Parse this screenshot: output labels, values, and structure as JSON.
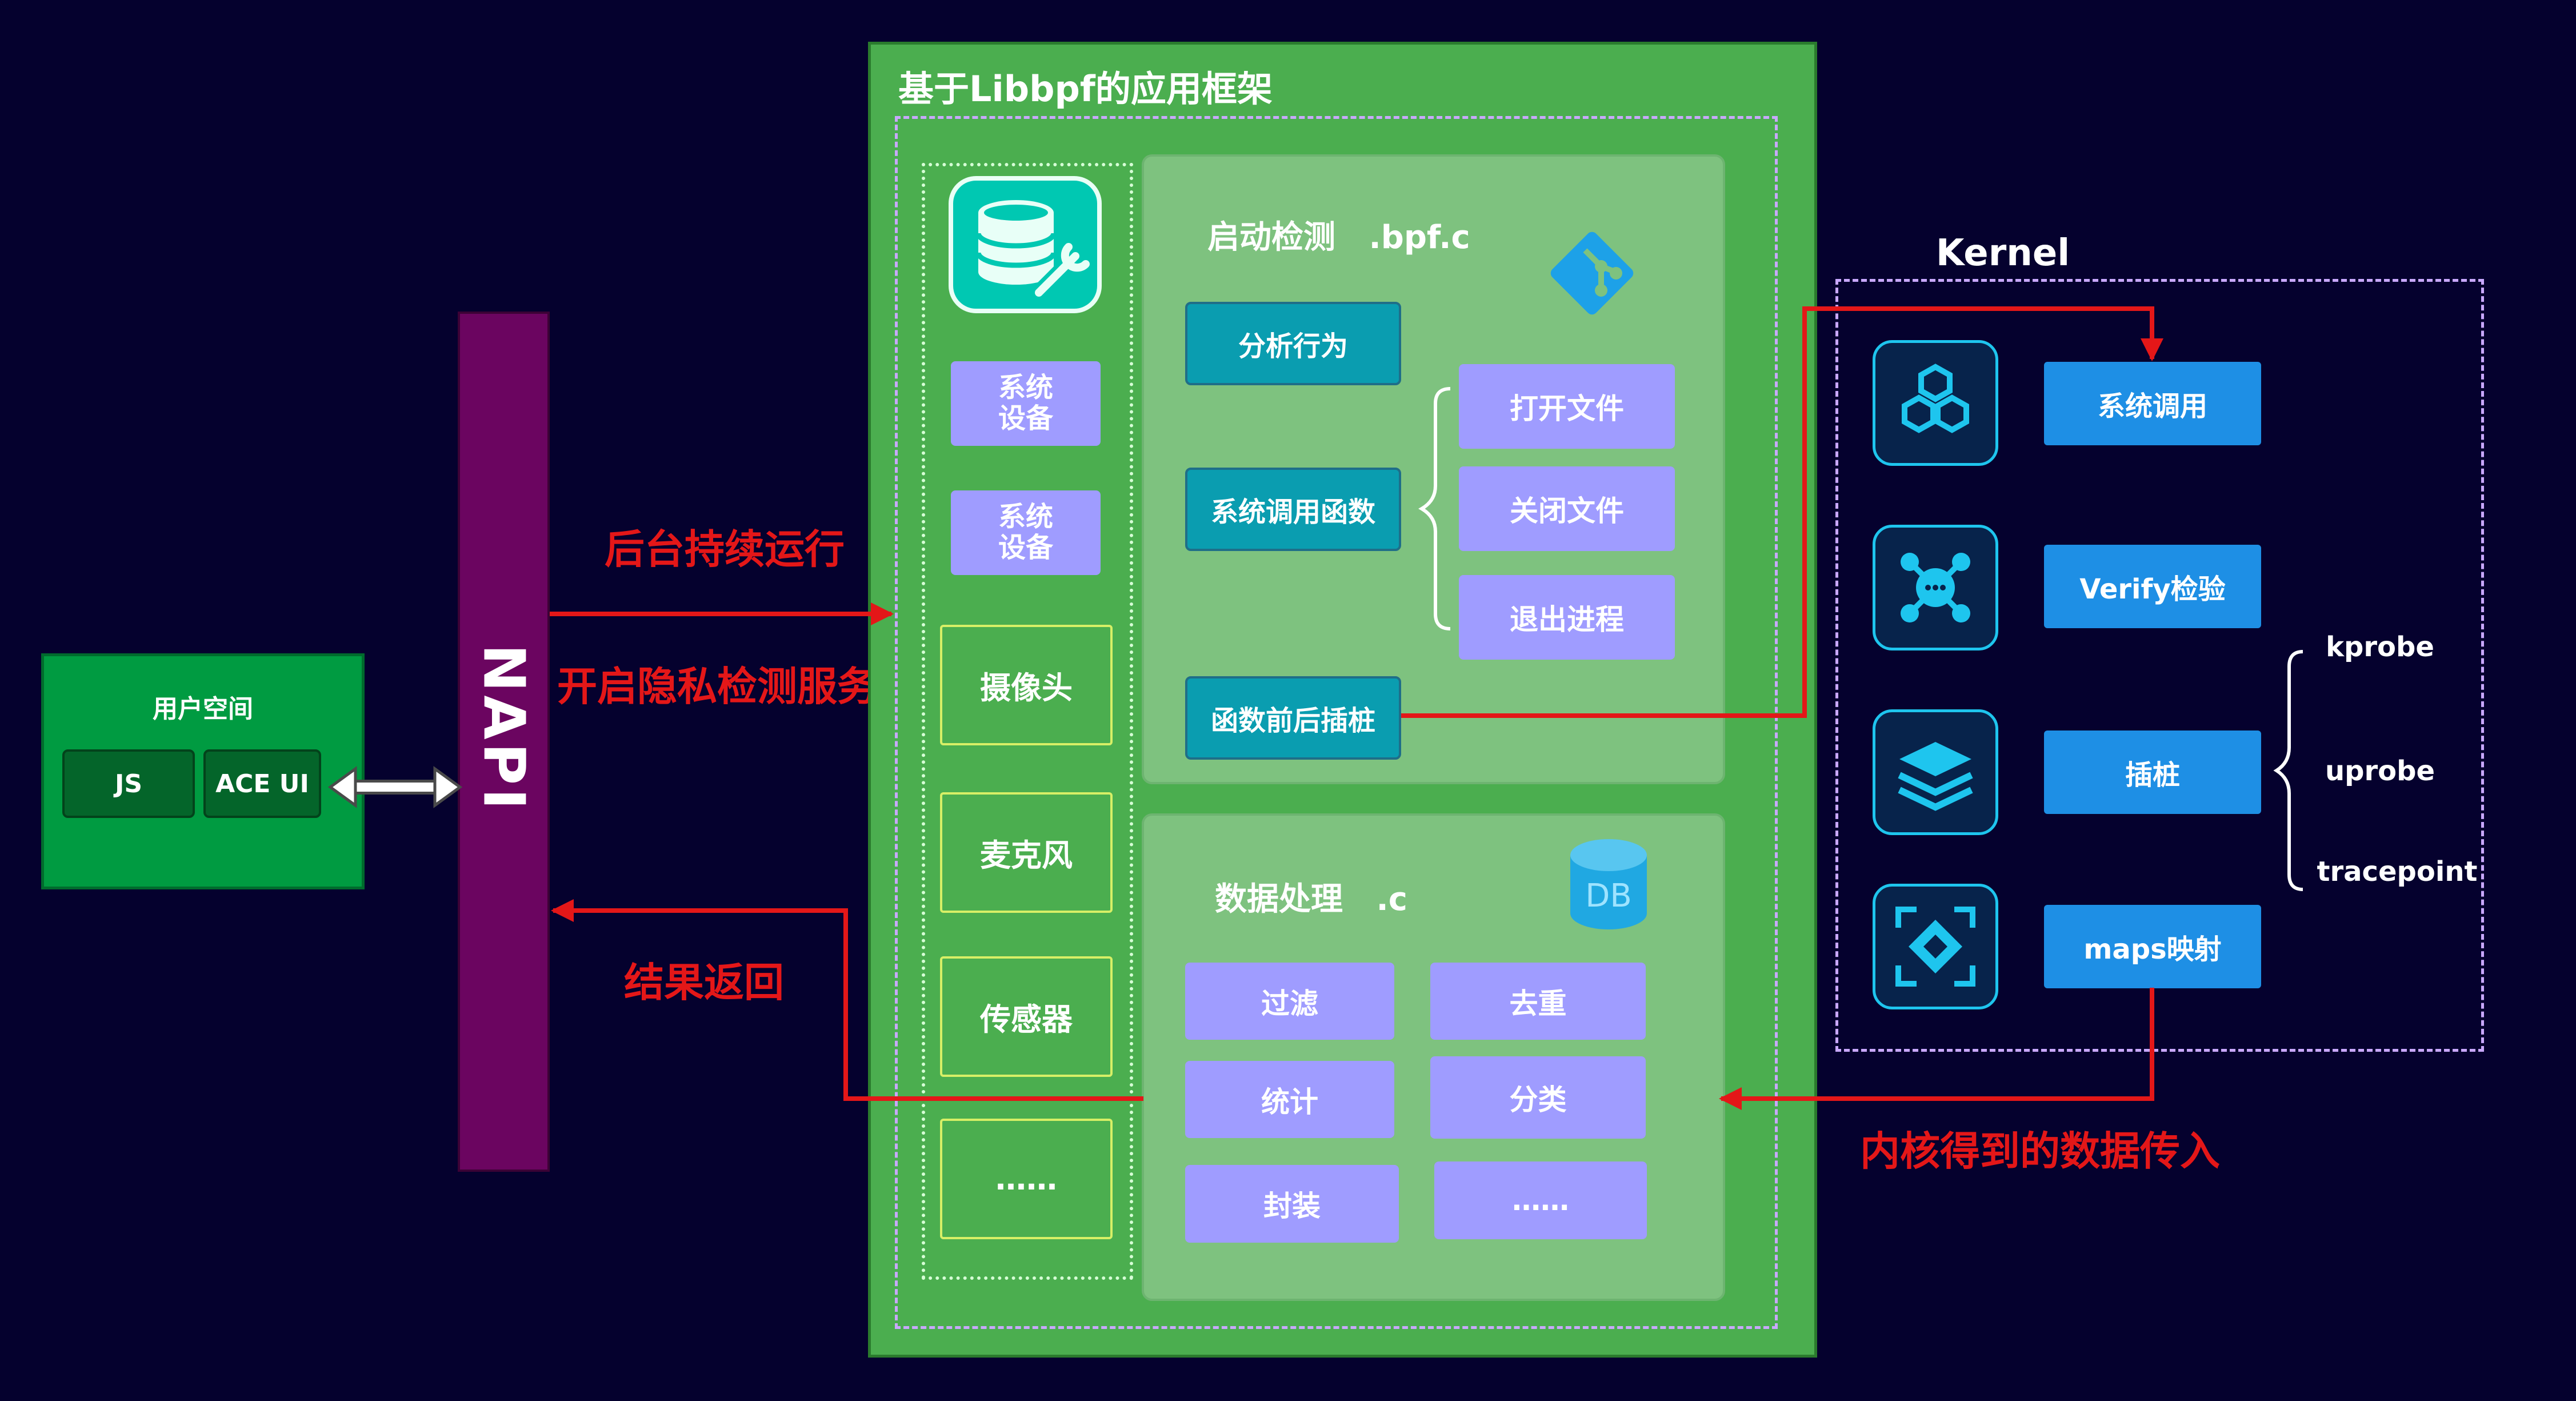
{
  "user_space": {
    "title": "用户空间",
    "js": "JS",
    "ace_ui": "ACE UI"
  },
  "napi": {
    "label": "NAPI"
  },
  "arrows": {
    "background_run": "后台持续运行",
    "start_detect": "开启隐私检测服务",
    "result_return": "结果返回",
    "kernel_data_in": "内核得到的数据传入"
  },
  "framework": {
    "title": "基于Libbpf的应用框架",
    "devices": {
      "db_tool_icon": "database-wrench-icon",
      "sys_device_1": [
        "系统",
        "设备"
      ],
      "sys_device_2": [
        "系统",
        "设备"
      ],
      "camera": "摄像头",
      "microphone": "麦克风",
      "sensor": "传感器",
      "more": "……"
    },
    "detect_panel": {
      "title": "启动检测   .bpf.c",
      "git_icon": "git-branch-icon",
      "analyze": "分析行为",
      "syscall_func": "系统调用函数",
      "hook": "函数前后插桩",
      "open_file": "打开文件",
      "close_file": "关闭文件",
      "exit_process": "退出进程"
    },
    "data_panel": {
      "title": "数据处理   .c",
      "db_icon_text": "DB",
      "filter": "过滤",
      "dedup": "去重",
      "stats": "统计",
      "classify": "分类",
      "encapsulate": "封装",
      "more": "……"
    }
  },
  "kernel": {
    "label": "Kernel",
    "icons": [
      "hexagons-icon",
      "network-nodes-icon",
      "layers-icon",
      "focus-frame-icon"
    ],
    "items": [
      "系统调用",
      "Verify检验",
      "插桩",
      "maps映射"
    ],
    "probes": [
      "kprobe",
      "uprobe",
      "tracepoint"
    ]
  },
  "colors": {
    "background": "#05012e",
    "user_space": "#009b41",
    "napi": "#6b0560",
    "framework": "#4bae4f",
    "panel": "#7ec27f",
    "teal_box": "#0a9db0",
    "lavender_box": "#9f9cff",
    "kernel_button": "#1e8fe5",
    "arrow_red": "#e41718",
    "dashed_border": "#c9a8ff"
  }
}
